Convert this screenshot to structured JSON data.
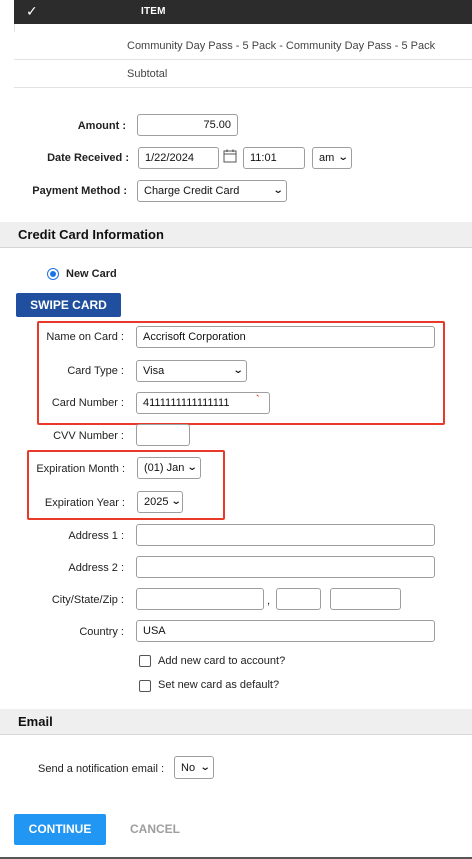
{
  "table": {
    "check_glyph": "✓",
    "header_item": "ITEM",
    "rows": [
      "Community Day Pass - 5 Pack - Community Day Pass - 5 Pack",
      "Subtotal"
    ]
  },
  "payment": {
    "amount_label": "Amount :",
    "amount_value": "75.00",
    "date_label": "Date Received :",
    "date_value": "1/22/2024",
    "time_value": "11:01",
    "ampm_value": "am",
    "method_label": "Payment Method :",
    "method_value": "Charge Credit Card"
  },
  "credit_card": {
    "section_title": "Credit Card Information",
    "new_card_label": "New Card",
    "swipe_label": "SWIPE CARD",
    "name_label": "Name on Card :",
    "name_value": "Accrisoft Corporation",
    "type_label": "Card Type :",
    "type_value": "Visa",
    "number_label": "Card Number :",
    "number_value": "4111111111111111",
    "cvv_label": "CVV Number :",
    "cvv_value": "",
    "exp_month_label": "Expiration Month :",
    "exp_month_value": "(01) Jan",
    "exp_year_label": "Expiration Year :",
    "exp_year_value": "2025",
    "address1_label": "Address 1 :",
    "address1_value": "",
    "address2_label": "Address 2 :",
    "address2_value": "",
    "csz_label": "City/State/Zip :",
    "csz_separator": ",",
    "country_label": "Country :",
    "country_value": "USA",
    "add_card_label": "Add new card to account?",
    "default_card_label": "Set new card as default?"
  },
  "email": {
    "section_title": "Email",
    "notify_label": "Send a notification email :",
    "notify_value": "No"
  },
  "actions": {
    "continue_label": "CONTINUE",
    "cancel_label": "CANCEL"
  },
  "colors": {
    "highlight": "#e8392b",
    "swipe_button": "#1f4f9e",
    "continue_button": "#2196f3"
  }
}
